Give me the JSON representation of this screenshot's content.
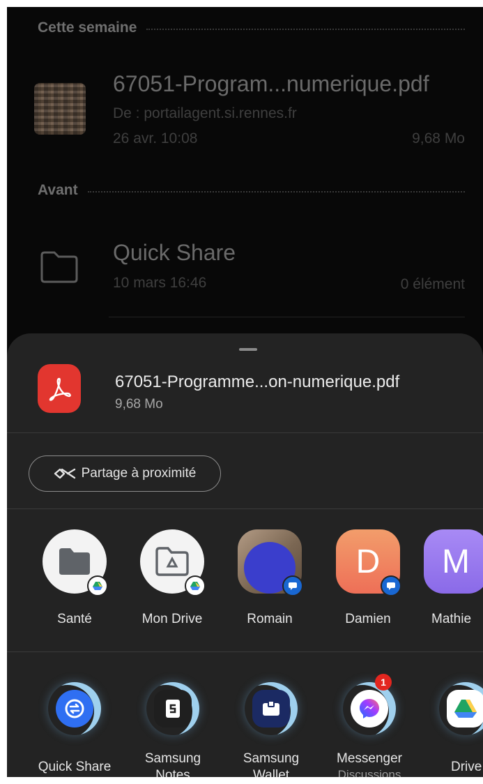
{
  "background_list": {
    "sections": [
      {
        "header": "Cette semaine"
      },
      {
        "header": "Avant"
      }
    ],
    "items": [
      {
        "title": "67051-Program...numerique.pdf",
        "source": "De : portailagent.si.rennes.fr",
        "date": "26 avr. 10:08",
        "size": "9,68 Mo",
        "icon": "pdf-thumbnail"
      },
      {
        "title": "Quick Share",
        "date": "10 mars 16:46",
        "count": "0 élément",
        "icon": "folder-icon"
      }
    ]
  },
  "share_sheet": {
    "file": {
      "name": "67051-Programme...on-numerique.pdf",
      "size": "9,68 Mo",
      "icon": "acrobat-icon",
      "icon_color": "#e2362f"
    },
    "nearby_share": {
      "label": "Partage à proximité",
      "icon": "nearby-share-icon"
    },
    "direct_targets": [
      {
        "label": "Santé",
        "icon": "folder-icon",
        "badge": "google-drive-icon"
      },
      {
        "label": "Mon Drive",
        "icon": "drive-folder-icon",
        "badge": "google-drive-icon"
      },
      {
        "label": "Romain",
        "icon": "avatar-photo",
        "badge": "messages-icon"
      },
      {
        "label": "Damien",
        "initial": "D",
        "color": "#f08a5c",
        "badge": "messages-icon"
      },
      {
        "label": "Mathie",
        "initial": "M",
        "color": "#9c7cf2"
      }
    ],
    "apps": [
      {
        "label": "Quick Share",
        "sublabel": "",
        "icon": "quick-share-icon"
      },
      {
        "label": "Samsung Notes",
        "label_line1": "Samsung",
        "label_line2": "Notes",
        "icon": "samsung-notes-icon"
      },
      {
        "label": "Samsung Wallet",
        "label_line1": "Samsung",
        "label_line2": "Wallet",
        "icon": "samsung-wallet-icon"
      },
      {
        "label": "Messenger",
        "sublabel": "Discussions",
        "icon": "messenger-icon",
        "badge_count": "1"
      },
      {
        "label": "Drive",
        "icon": "google-drive-icon"
      }
    ]
  }
}
